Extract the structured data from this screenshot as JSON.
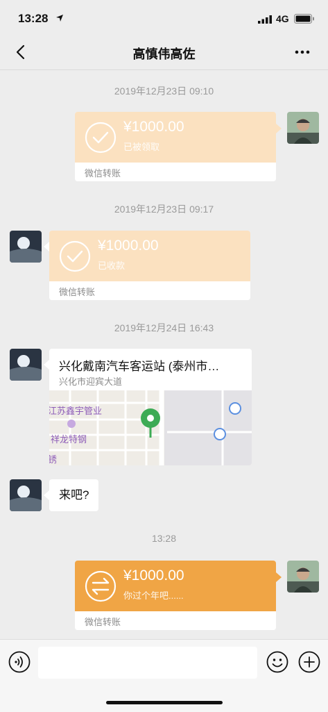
{
  "status_bar": {
    "time": "13:28",
    "network": "4G"
  },
  "nav": {
    "title": "高慎伟高佐",
    "back_icon": "chevron-left-icon",
    "more_icon": "more-dots-icon"
  },
  "messages": {
    "ts1": "2019年12月23日 09:10",
    "t1": {
      "amount": "¥1000.00",
      "status": "已被领取",
      "footer": "微信转账"
    },
    "ts2": "2019年12月23日 09:17",
    "t2": {
      "amount": "¥1000.00",
      "status": "已收款",
      "footer": "微信转账"
    },
    "ts3": "2019年12月24日 16:43",
    "location": {
      "title": "兴化戴南汽车客运站 (泰州市…",
      "address": "兴化市迎宾大道",
      "map_labels": [
        "江苏鑫宇管业",
        "祥龙特钢",
        "锈"
      ]
    },
    "text1": "来吧?",
    "ts4": "13:28",
    "t3": {
      "amount": "¥1000.00",
      "note": "你过个年吧......",
      "footer": "微信转账"
    }
  },
  "input_bar": {
    "placeholder": "",
    "voice_icon": "voice-icon",
    "emoji_icon": "emoji-icon",
    "plus_icon": "plus-icon"
  },
  "colors": {
    "transfer_done": "#fbe1c0",
    "transfer_active": "#f0a545",
    "background": "#ededed"
  }
}
